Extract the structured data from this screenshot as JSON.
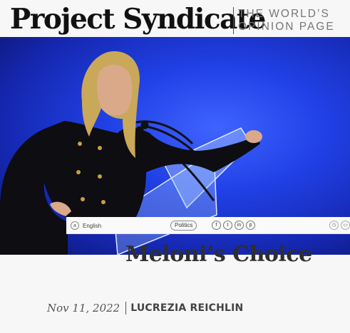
{
  "site": {
    "brand": "Project Syndicate",
    "tagline_line1": "THE WORLD’S",
    "tagline_line2": "OPINION PAGE"
  },
  "hero": {
    "subject": "speaker at a transparent podium against a blue backdrop"
  },
  "toolbar": {
    "language_label": "English",
    "category_label": "Politics",
    "share_icons": [
      "facebook-icon",
      "twitter-icon",
      "linkedin-icon",
      "pinterest-icon"
    ],
    "tool_icons": [
      "clock-icon",
      "bookmark-icon"
    ]
  },
  "article": {
    "title": "Meloni’s Choice",
    "date": "Nov 11, 2022",
    "author": "LUCREZIA REICHLIN"
  },
  "colors": {
    "accent": "#b3202a",
    "hero_blue": "#2141e6"
  }
}
